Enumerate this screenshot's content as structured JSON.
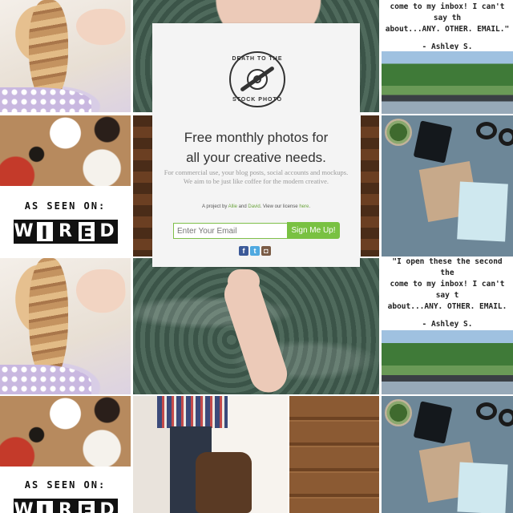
{
  "brand": {
    "logo_top": "DEATH TO THE",
    "logo_bottom": "STOCK PHOTO"
  },
  "signup_card": {
    "headline_line1": "Free monthly photos for",
    "headline_line2": "all your creative needs.",
    "description_line1": "For commercial use, your blog posts, social accounts and mockups.",
    "description_line2": "We aim to be just like coffee for the modern creative.",
    "project_prefix": "A project by ",
    "author1": "Allie",
    "and_text": " and ",
    "author2": "David",
    "license_text": ".  View our license ",
    "license_link": "here",
    "email_placeholder": "Enter Your Email",
    "submit_label": "Sign Me Up!"
  },
  "social": {
    "facebook": "f",
    "twitter": "t",
    "instagram": "◘"
  },
  "quote_top": {
    "line1": "come to my inbox! I can't say th",
    "line2": "about...ANY. OTHER. EMAIL.\"",
    "author": "- Ashley S."
  },
  "quote_mid": {
    "line1": "\"I open these the second the",
    "line2": "come to my inbox! I can't say t",
    "line3": "about...ANY. OTHER. EMAIL.",
    "author": "- Ashley S."
  },
  "press": {
    "as_seen_on": "AS SEEN ON:",
    "logo_letters": [
      "W",
      "I",
      "R",
      "E",
      "D"
    ]
  },
  "icons": [
    "facebook-icon",
    "twitter-icon",
    "instagram-icon",
    "logo-icon"
  ]
}
